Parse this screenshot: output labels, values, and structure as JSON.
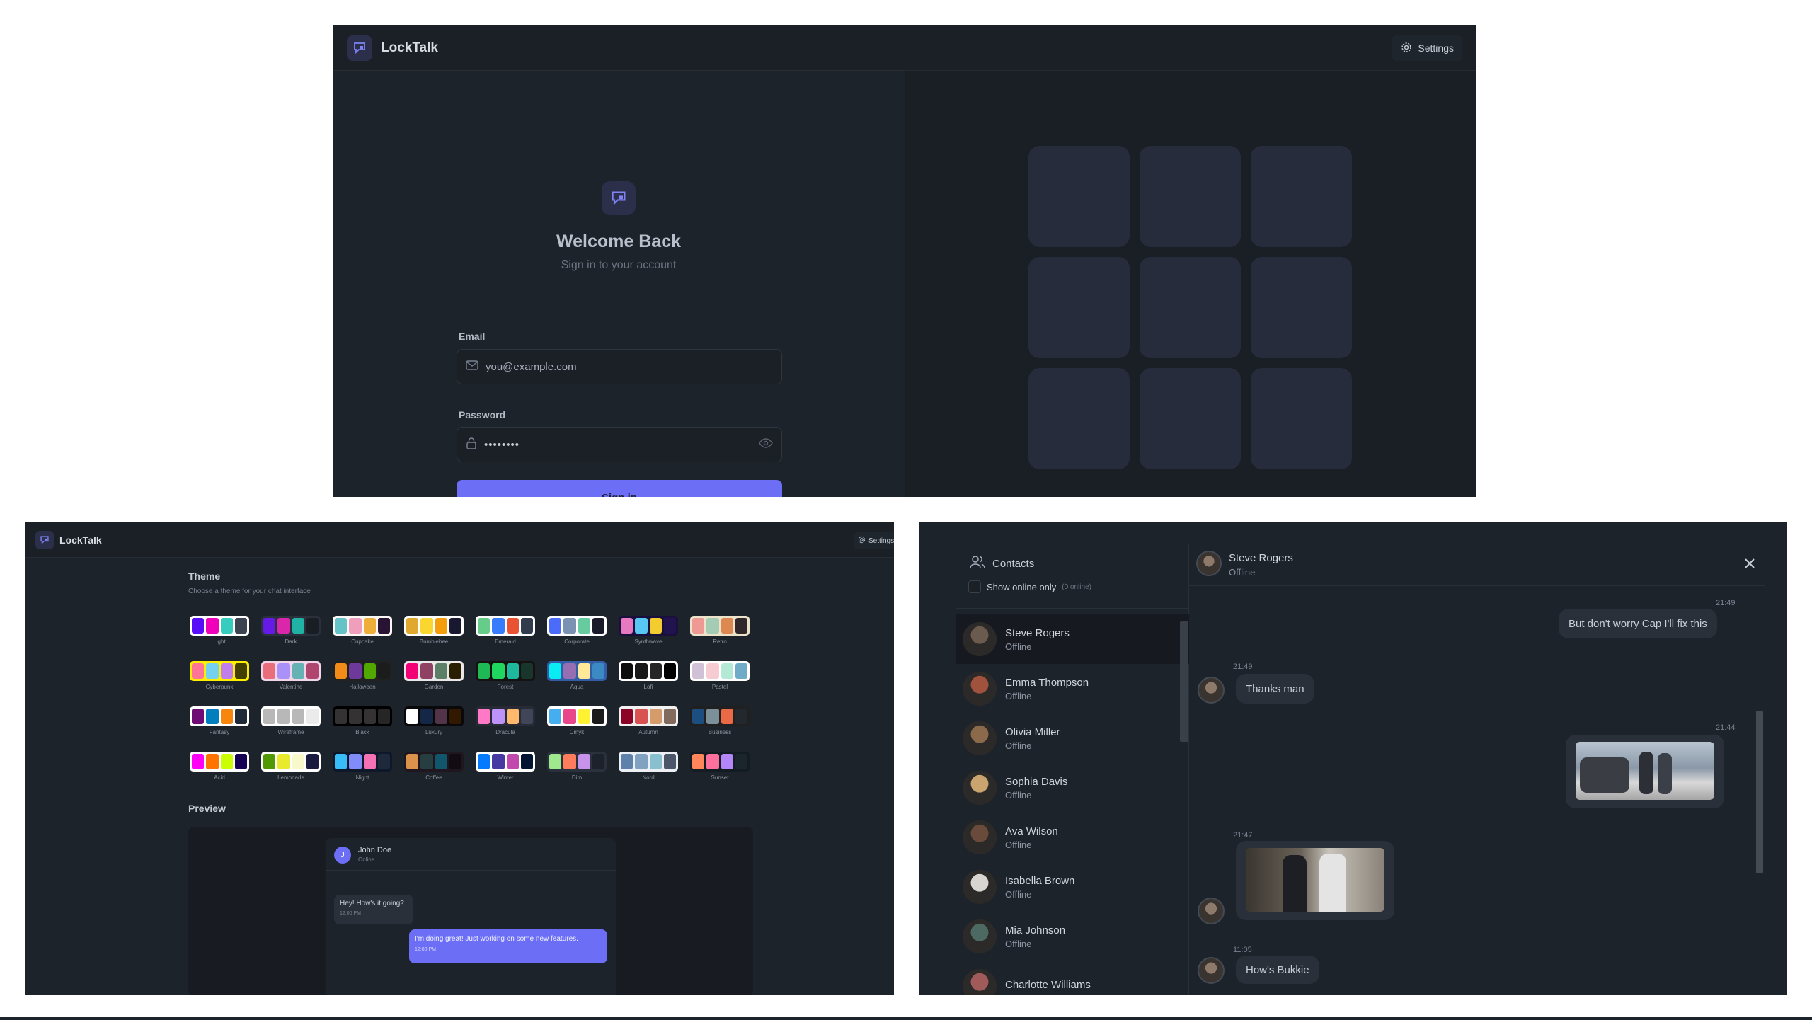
{
  "login": {
    "brand": "LockTalk",
    "settings": "Settings",
    "title": "Welcome Back",
    "subtitle": "Sign in to your account",
    "email_label": "Email",
    "email_placeholder": "you@example.com",
    "password_label": "Password",
    "password_value": "••••••••",
    "signin": "Sign in"
  },
  "settings_page": {
    "brand": "LockTalk",
    "settings": "Settings",
    "theme_title": "Theme",
    "theme_sub": "Choose a theme for your chat interface",
    "themes": [
      {
        "name": "Light",
        "colors": [
          "#570df8",
          "#f000b8",
          "#37cdbe",
          "#3d4451"
        ],
        "bg": "#ffffff"
      },
      {
        "name": "Dark",
        "colors": [
          "#661ae6",
          "#d926aa",
          "#1fb2a5",
          "#191d24"
        ],
        "bg": "#2a303c"
      },
      {
        "name": "Cupcake",
        "colors": [
          "#65c3c8",
          "#ef9fbc",
          "#eeaf3a",
          "#291334"
        ],
        "bg": "#faf7f5"
      },
      {
        "name": "Bumblebee",
        "colors": [
          "#e0a82e",
          "#f9d72f",
          "#f59e0b",
          "#181830"
        ],
        "bg": "#ffffff"
      },
      {
        "name": "Emerald",
        "colors": [
          "#66cc8a",
          "#377cfb",
          "#ea5234",
          "#333c4d"
        ],
        "bg": "#ffffff"
      },
      {
        "name": "Corporate",
        "colors": [
          "#4b6bfb",
          "#7b92b2",
          "#67cba0",
          "#181a2a"
        ],
        "bg": "#ffffff"
      },
      {
        "name": "Synthwave",
        "colors": [
          "#e779c1",
          "#58c7f3",
          "#f3cc30",
          "#20134e"
        ],
        "bg": "#1a103d"
      },
      {
        "name": "Retro",
        "colors": [
          "#ef9995",
          "#a4cbb4",
          "#dc8850",
          "#2e282a"
        ],
        "bg": "#ece3ca"
      },
      {
        "name": "Cyberpunk",
        "colors": [
          "#ff7598",
          "#75d1f0",
          "#c07eec",
          "#423f00"
        ],
        "bg": "#ffee00"
      },
      {
        "name": "Valentine",
        "colors": [
          "#e96d7b",
          "#a991f7",
          "#66b1b3",
          "#af4670"
        ],
        "bg": "#f0d6e8"
      },
      {
        "name": "Halloween",
        "colors": [
          "#f28c18",
          "#6d3a9c",
          "#51a800",
          "#1b1d1d"
        ],
        "bg": "#212121"
      },
      {
        "name": "Garden",
        "colors": [
          "#f40076",
          "#8e4162",
          "#5c7f67",
          "#291e00"
        ],
        "bg": "#e9e7e7"
      },
      {
        "name": "Forest",
        "colors": [
          "#1eb854",
          "#1fd65f",
          "#1eb89c",
          "#19362d"
        ],
        "bg": "#171212"
      },
      {
        "name": "Aqua",
        "colors": [
          "#09ecf3",
          "#966fb3",
          "#ffe999",
          "#3b8ac4"
        ],
        "bg": "#345da7"
      },
      {
        "name": "Lofi",
        "colors": [
          "#0d0d0d",
          "#1a1919",
          "#262626",
          "#000000"
        ],
        "bg": "#ffffff"
      },
      {
        "name": "Pastel",
        "colors": [
          "#d1c1d7",
          "#f6cbd1",
          "#b4e9d6",
          "#70acc7"
        ],
        "bg": "#ffffff"
      },
      {
        "name": "Fantasy",
        "colors": [
          "#6e0b75",
          "#007ebd",
          "#f8860d",
          "#1f2937"
        ],
        "bg": "#ffffff"
      },
      {
        "name": "Wireframe",
        "colors": [
          "#b8b8b8",
          "#b8b8b8",
          "#b8b8b8",
          "#ebebeb"
        ],
        "bg": "#ffffff"
      },
      {
        "name": "Black",
        "colors": [
          "#343232",
          "#343232",
          "#343232",
          "#272626"
        ],
        "bg": "#000000"
      },
      {
        "name": "Luxury",
        "colors": [
          "#ffffff",
          "#152747",
          "#513448",
          "#331800"
        ],
        "bg": "#09090b"
      },
      {
        "name": "Dracula",
        "colors": [
          "#ff79c6",
          "#bd93f9",
          "#ffb86c",
          "#414558"
        ],
        "bg": "#282a36"
      },
      {
        "name": "Cmyk",
        "colors": [
          "#45aeee",
          "#e8488a",
          "#fff232",
          "#1a1a1a"
        ],
        "bg": "#ffffff"
      },
      {
        "name": "Autumn",
        "colors": [
          "#8c0327",
          "#d85251",
          "#d59b6a",
          "#826a5c"
        ],
        "bg": "#f1f1f1"
      },
      {
        "name": "Business",
        "colors": [
          "#1c4e80",
          "#7c909a",
          "#ea6947",
          "#23282e"
        ],
        "bg": "#202020"
      },
      {
        "name": "Acid",
        "colors": [
          "#ff00f4",
          "#ff7400",
          "#cbfd03",
          "#140152"
        ],
        "bg": "#fafafa"
      },
      {
        "name": "Lemonade",
        "colors": [
          "#519903",
          "#e9e92e",
          "#f7f9ca",
          "#191a3e"
        ],
        "bg": "#ffffff"
      },
      {
        "name": "Night",
        "colors": [
          "#38bdf8",
          "#818cf8",
          "#f471b5",
          "#1e293b"
        ],
        "bg": "#0f172a"
      },
      {
        "name": "Coffee",
        "colors": [
          "#db924b",
          "#263e3f",
          "#10576d",
          "#120c12"
        ],
        "bg": "#20161f"
      },
      {
        "name": "Winter",
        "colors": [
          "#047aff",
          "#463aa2",
          "#c148ac",
          "#021431"
        ],
        "bg": "#ffffff"
      },
      {
        "name": "Dim",
        "colors": [
          "#9fe88d",
          "#ff7d5c",
          "#c792e9",
          "#1c212b"
        ],
        "bg": "#2a303c"
      },
      {
        "name": "Nord",
        "colors": [
          "#5e81ac",
          "#81a1c1",
          "#88c0d0",
          "#4c566a"
        ],
        "bg": "#eceff4"
      },
      {
        "name": "Sunset",
        "colors": [
          "#ff865b",
          "#fd6f9c",
          "#b387fa",
          "#1b262c"
        ],
        "bg": "#121c22"
      }
    ],
    "preview_title": "Preview",
    "preview_user": "John Doe",
    "preview_status": "Online",
    "preview_initial": "J",
    "preview_msg1": "Hey! How's it going?",
    "preview_msg1_time": "12:00 PM",
    "preview_msg2": "I'm doing great! Just working on some new features.",
    "preview_msg2_time": "12:00 PM"
  },
  "chat": {
    "contacts_title": "Contacts",
    "show_online": "Show online only",
    "online_count": "(0 online)",
    "contacts": [
      {
        "name": "Steve Rogers",
        "status": "Offline",
        "color": "#6b5a4e"
      },
      {
        "name": "Emma Thompson",
        "status": "Offline",
        "color": "#a0523d"
      },
      {
        "name": "Olivia Miller",
        "status": "Offline",
        "color": "#8a6a4a"
      },
      {
        "name": "Sophia Davis",
        "status": "Offline",
        "color": "#c9a46e"
      },
      {
        "name": "Ava Wilson",
        "status": "Offline",
        "color": "#6a4a3a"
      },
      {
        "name": "Isabella Brown",
        "status": "Offline",
        "color": "#d8d4d0"
      },
      {
        "name": "Mia Johnson",
        "status": "Offline",
        "color": "#4d6a62"
      },
      {
        "name": "Charlotte Williams",
        "status": "",
        "color": "#a05a5a"
      }
    ],
    "header_name": "Steve Rogers",
    "header_status": "Offline",
    "messages": [
      {
        "time": "21:49",
        "text": "But don't worry Cap I'll fix this"
      },
      {
        "time": "21:49",
        "text": "Thanks man"
      },
      {
        "time": "21:44",
        "text": ""
      },
      {
        "time": "21:47",
        "text": ""
      },
      {
        "time": "11:05",
        "text": "How's Bukkie"
      }
    ]
  }
}
